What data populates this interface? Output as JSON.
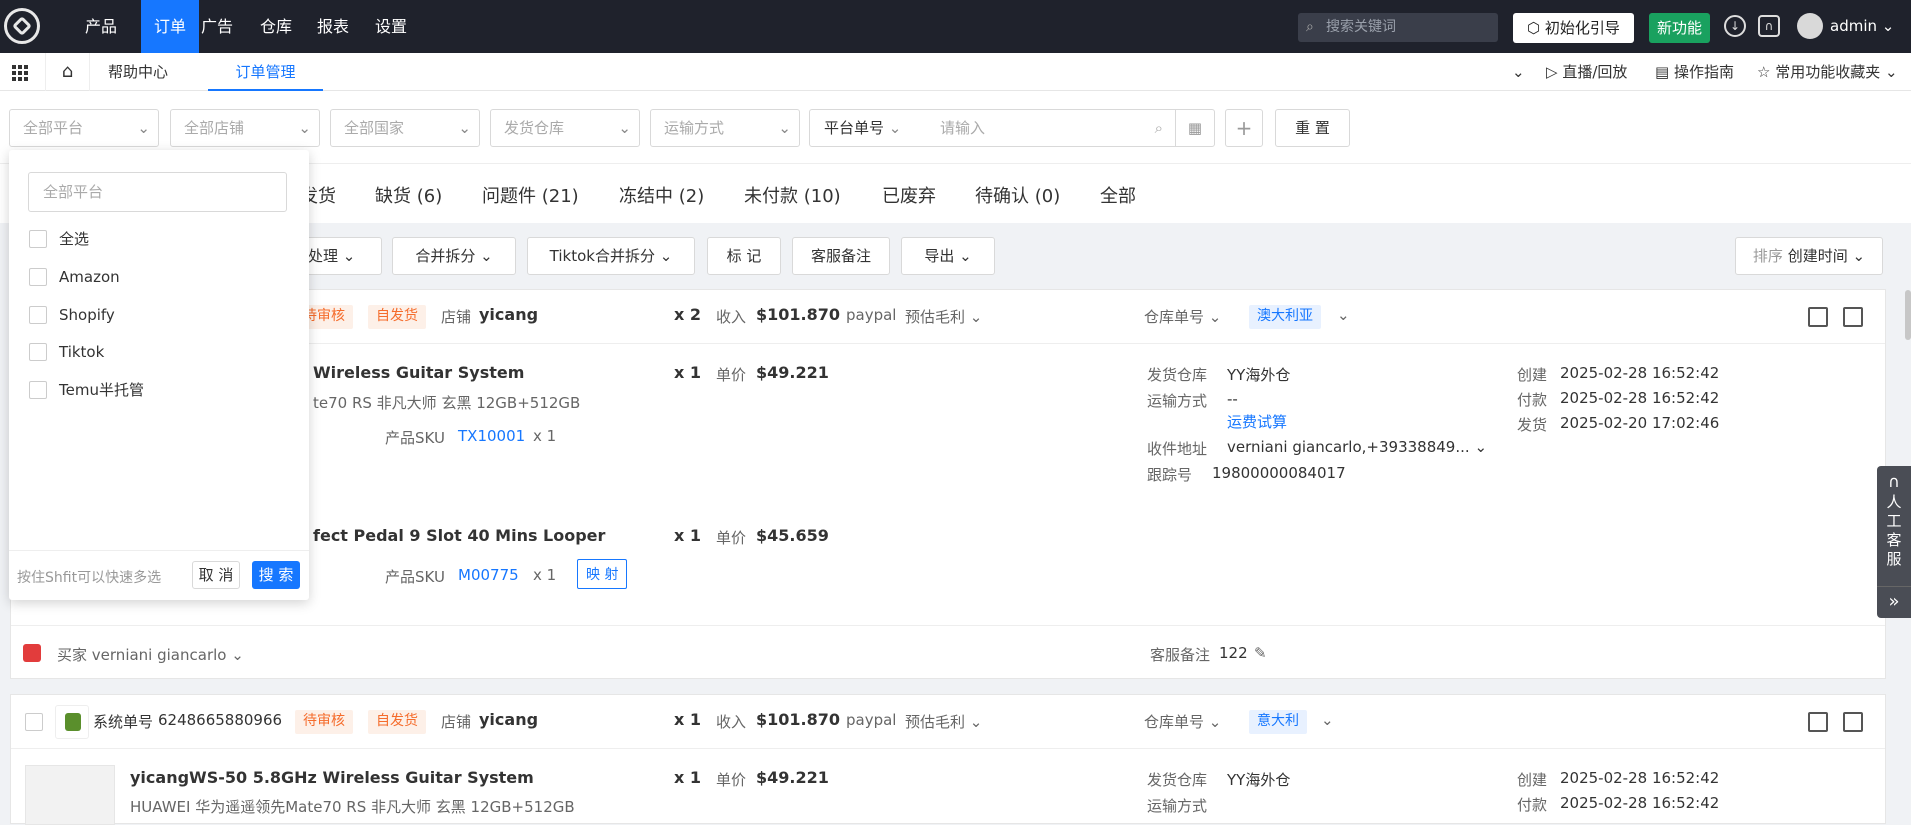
{
  "topnav": {
    "items": [
      "产品",
      "订单",
      "广告",
      "仓库",
      "报表",
      "设置"
    ],
    "active_index": 1,
    "search_placeholder": "搜索关键词",
    "init_guide": "初始化引导",
    "new_feature": "新功能",
    "user": "admin"
  },
  "tabs": {
    "help": "帮助中心",
    "order_mgmt": "订单管理",
    "live": "直播/回放",
    "guide": "操作指南",
    "fav": "常用功能收藏夹"
  },
  "filters": {
    "platform": "全部平台",
    "store": "全部店铺",
    "country": "全部国家",
    "warehouse": "发货仓库",
    "shipping": "运输方式",
    "order_no_type": "平台单号",
    "input_placeholder": "请输入",
    "reset": "重 置"
  },
  "status_tabs": [
    "发货",
    "缺货 (6)",
    "问题件 (21)",
    "冻结中 (2)",
    "未付款 (10)",
    "已废弃",
    "待确认 (0)",
    "全部"
  ],
  "toolbar": {
    "process": "处理",
    "merge_split": "合并拆分",
    "tiktok_merge": "Tiktok合并拆分",
    "mark": "标 记",
    "cs_note": "客服备注",
    "export": "导出",
    "sort_label": "排序",
    "sort_value": "创建时间"
  },
  "dropdown": {
    "placeholder": "全部平台",
    "options": [
      "全选",
      "Amazon",
      "Shopify",
      "Tiktok",
      "Temu半托管"
    ],
    "hint": "按住Shfit可以快速多选",
    "cancel": "取 消",
    "search": "搜 索"
  },
  "order1": {
    "status": "待审核",
    "ship_type": "自发货",
    "store_label": "店铺",
    "store": "yicang",
    "qty": "x 2",
    "income_label": "收入",
    "income": "$101.870",
    "pay": "paypal",
    "profit_label": "预估毛利",
    "wh_no_label": "仓库单号",
    "country": "澳大利亚",
    "item1": {
      "title": "Wireless Guitar System",
      "variant": "te70 RS 非凡大师 玄黑 12GB+512GB",
      "qty": "x 1",
      "price_label": "单价",
      "price": "$49.221",
      "sku_label": "产品SKU",
      "sku": "TX10001",
      "sku_qty": "x 1"
    },
    "item2": {
      "title": "fect Pedal 9 Slot 40 Mins Looper",
      "qty": "x 1",
      "price_label": "单价",
      "price": "$45.659",
      "sku_label": "产品SKU",
      "sku": "M00775",
      "sku_qty": "x 1",
      "map": "映 射"
    },
    "warehouse_label": "发货仓库",
    "warehouse": "YY海外仓",
    "ship_label": "运输方式",
    "ship": "--",
    "freight": "运费试算",
    "addr_label": "收件地址",
    "addr": "verniani giancarlo,+39338849...",
    "track_label": "跟踪号",
    "track": "19800000084017",
    "created_label": "创建",
    "created": "2025-02-28 16:52:42",
    "paid_label": "付款",
    "paid": "2025-02-28 16:52:42",
    "shipped_label": "发货",
    "shipped": "2025-02-20 17:02:46",
    "buyer_label": "买家",
    "buyer": "verniani giancarlo",
    "cs_note_label": "客服备注",
    "cs_note": "122"
  },
  "order2": {
    "sys_label": "系统单号",
    "sys_no": "6248665880966",
    "status": "待审核",
    "ship_type": "自发货",
    "store_label": "店铺",
    "store": "yicang",
    "qty": "x 1",
    "income_label": "收入",
    "income": "$101.870",
    "pay": "paypal",
    "profit_label": "预估毛利",
    "wh_no_label": "仓库单号",
    "country": "意大利",
    "item_title": "yicangWS-50 5.8GHz Wireless Guitar System",
    "item_variant": "HUAWEI 华为遥遥领先Mate70 RS 非凡大师 玄黑 12GB+512GB",
    "price_label": "单价",
    "price": "$49.221",
    "warehouse_label": "发货仓库",
    "warehouse": "YY海外仓",
    "ship_label": "运输方式",
    "created_label": "创建",
    "created": "2025-02-28 16:52:42",
    "paid_label": "付款",
    "paid": "2025-02-28 16:52:42"
  },
  "service": {
    "label": "人工客服"
  }
}
